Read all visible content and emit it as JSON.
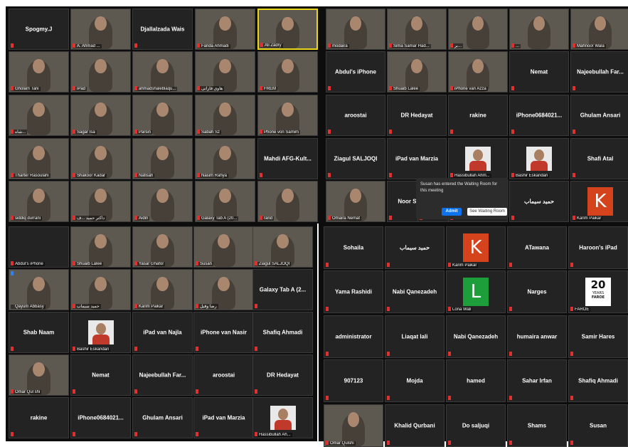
{
  "colors": {
    "active_speaker": "#e8d619",
    "muted": "#e03131",
    "admit": "#0e72ed"
  },
  "notification": {
    "message": "Susan has entered the Waiting Room for this meeting",
    "admit_label": "Admit",
    "see_label": "See Waiting Room"
  },
  "grids": [
    {
      "name": "top-left",
      "tiles": [
        {
          "kind": "name",
          "name": "Spogmy.J"
        },
        {
          "kind": "video",
          "label": "A. Ahmad ..."
        },
        {
          "kind": "name",
          "name": "Djallalzada Wais"
        },
        {
          "kind": "video",
          "label": "Farida Ahmadi"
        },
        {
          "kind": "video",
          "label": "Ali Zadry",
          "active": true
        },
        {
          "kind": "video",
          "label": "Gholam Tani"
        },
        {
          "kind": "video",
          "label": "iPad"
        },
        {
          "kind": "video",
          "label": "ahmadshaleblaqu..."
        },
        {
          "kind": "video",
          "label": "هاوی فارانی"
        },
        {
          "kind": "video",
          "label": "FREM"
        },
        {
          "kind": "video",
          "label": "شاه..."
        },
        {
          "kind": "video",
          "label": "Sagar Isa"
        },
        {
          "kind": "video",
          "label": "Parsin"
        },
        {
          "kind": "video",
          "label": "Sabah Sz"
        },
        {
          "kind": "video",
          "label": "Phone von Samim"
        },
        {
          "kind": "video",
          "label": "Tharter Rasoulahi"
        },
        {
          "kind": "video",
          "label": "Shakoor Kadar"
        },
        {
          "kind": "video",
          "label": "Nafisah"
        },
        {
          "kind": "video",
          "label": "Nasim Rahya"
        },
        {
          "kind": "name",
          "name": "Mahdi AFG-Kult..."
        },
        {
          "kind": "video",
          "label": "siddiq durrani"
        },
        {
          "kind": "video",
          "label": "داکتر حمید ...ف"
        },
        {
          "kind": "video",
          "label": "Aidin"
        },
        {
          "kind": "video",
          "label": "Galaxy Tab A (20..."
        },
        {
          "kind": "video",
          "label": "rand"
        }
      ]
    },
    {
      "name": "top-right",
      "tiles": [
        {
          "kind": "video",
          "label": "modaira"
        },
        {
          "kind": "video",
          "label": "Sima Samar Had..."
        },
        {
          "kind": "video",
          "label": "بر..."
        },
        {
          "kind": "video",
          "label": "..."
        },
        {
          "kind": "video",
          "label": "Mahnoor Wala"
        },
        {
          "kind": "name",
          "name": "Abdul's iPhone",
          "small": true
        },
        {
          "kind": "video",
          "label": "Shuaib Lalee"
        },
        {
          "kind": "video",
          "label": "iPhone van Azza"
        },
        {
          "kind": "name",
          "name": "Nemat"
        },
        {
          "kind": "name",
          "name": "Najeebullah Far..."
        },
        {
          "kind": "name",
          "name": "aroostai"
        },
        {
          "kind": "name",
          "name": "DR Hedayat"
        },
        {
          "kind": "name",
          "name": "rakine"
        },
        {
          "kind": "name",
          "name": "iPhone0684021..."
        },
        {
          "kind": "name",
          "name": "Ghulam Ansari"
        },
        {
          "kind": "name",
          "name": "Ziagul SALJOQI"
        },
        {
          "kind": "name",
          "name": "iPad van Marzia"
        },
        {
          "kind": "portrait",
          "label": "Hassibullah Ahm..."
        },
        {
          "kind": "portrait",
          "label": "Bashir Eskandari"
        },
        {
          "kind": "name",
          "name": "Shafi Atal"
        },
        {
          "kind": "video",
          "label": "Omaira Nemat"
        },
        {
          "kind": "name",
          "name": "Noor Saifzada"
        },
        {
          "kind": "name",
          "name": "Qayum ..."
        },
        {
          "kind": "name",
          "name": ""
        },
        {
          "kind": "name",
          "name": "حمید سیماب"
        },
        {
          "kind": "avatar",
          "letter": "K",
          "color": "#d4431c",
          "label": "Karim Paikar"
        }
      ]
    },
    {
      "name": "bottom-left",
      "tiles": [
        {
          "kind": "name",
          "name": "",
          "label": "Abdul's iPhone"
        },
        {
          "kind": "video",
          "label": "Shuaib Lalee"
        },
        {
          "kind": "video",
          "label": "Yasar Ghafor"
        },
        {
          "kind": "video",
          "label": "Susan"
        },
        {
          "kind": "video",
          "label": "Ziagul SALJOQI"
        },
        {
          "kind": "video",
          "label": "Qayum Abbasy",
          "blue": true
        },
        {
          "kind": "video",
          "label": "حمید سیماب"
        },
        {
          "kind": "video",
          "label": "Karim Paikar"
        },
        {
          "kind": "video",
          "label": "رضا وقیل"
        },
        {
          "kind": "name",
          "name": "Galaxy Tab A (2..."
        },
        {
          "kind": "name",
          "name": "Shab Naam"
        },
        {
          "kind": "portrait",
          "label": "Bashir Eskandari"
        },
        {
          "kind": "name",
          "name": "iPad van Najla"
        },
        {
          "kind": "name",
          "name": "iPhone van Nasir"
        },
        {
          "kind": "name",
          "name": "Shafiq Ahmadi"
        },
        {
          "kind": "video",
          "label": "Omar Qul shi"
        },
        {
          "kind": "name",
          "name": "Nemat"
        },
        {
          "kind": "name",
          "name": "Najeebullah Far..."
        },
        {
          "kind": "name",
          "name": "aroostai"
        },
        {
          "kind": "name",
          "name": "DR Hedayat"
        },
        {
          "kind": "name",
          "name": "rakine"
        },
        {
          "kind": "name",
          "name": "iPhone0684021..."
        },
        {
          "kind": "name",
          "name": "Ghulam Ansari"
        },
        {
          "kind": "name",
          "name": "iPad van Marzia"
        },
        {
          "kind": "portrait",
          "label": "Hassibullah Ah..."
        }
      ]
    },
    {
      "name": "bottom-right",
      "tiles": [
        {
          "kind": "name",
          "name": "Sohaila"
        },
        {
          "kind": "name",
          "name": "حمید سیماب"
        },
        {
          "kind": "avatar",
          "letter": "K",
          "color": "#d4431c",
          "label": "Karim Paikar"
        },
        {
          "kind": "name",
          "name": "ATawana"
        },
        {
          "kind": "name",
          "name": "Haroon's iPad"
        },
        {
          "kind": "name",
          "name": "Yama Rashidi"
        },
        {
          "kind": "name",
          "name": "Nabi Qanezadeh"
        },
        {
          "kind": "avatar",
          "letter": "L",
          "color": "#1e9e3a",
          "label": "Lona Wali"
        },
        {
          "kind": "name",
          "name": "Narges"
        },
        {
          "kind": "logo",
          "logo_num": "20",
          "logo_years": "YEARS",
          "logo_name": "FAROE",
          "label": "FAROE"
        },
        {
          "kind": "name",
          "name": "administrator"
        },
        {
          "kind": "name",
          "name": "Liaqat lali"
        },
        {
          "kind": "name",
          "name": "Nabi Qanezadeh"
        },
        {
          "kind": "name",
          "name": "humaira anwar"
        },
        {
          "kind": "name",
          "name": "Samir Hares"
        },
        {
          "kind": "name",
          "name": "907123"
        },
        {
          "kind": "name",
          "name": "Mojda"
        },
        {
          "kind": "name",
          "name": "hamed"
        },
        {
          "kind": "name",
          "name": "Sahar Irfan"
        },
        {
          "kind": "name",
          "name": "Shafiq Ahmadi"
        },
        {
          "kind": "video",
          "label": "Omar Qulshi"
        },
        {
          "kind": "name",
          "name": "Khalid Qurbani"
        },
        {
          "kind": "name",
          "name": "Do saljuqi"
        },
        {
          "kind": "name",
          "name": "Shams"
        },
        {
          "kind": "name",
          "name": "Susan"
        }
      ]
    }
  ]
}
